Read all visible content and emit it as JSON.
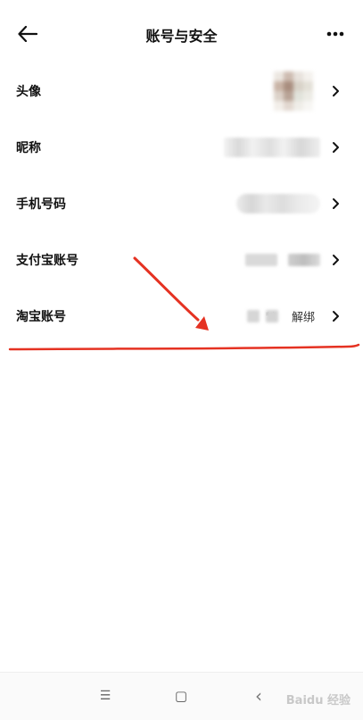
{
  "header": {
    "title": "账号与安全",
    "back_icon": "arrow-left-icon",
    "more_icon": "more-horizontal-icon"
  },
  "rows": [
    {
      "label": "头像"
    },
    {
      "label": "昵称"
    },
    {
      "label": "手机号码"
    },
    {
      "label": "支付宝账号"
    },
    {
      "label": "淘宝账号",
      "masked_text": "**",
      "action": "解绑"
    }
  ],
  "annotation": {
    "color": "#e53222"
  },
  "nav": {
    "menu_glyph": "☰",
    "home_glyph": "▢",
    "back_glyph": "‹"
  },
  "watermark": "Baidu 经验"
}
